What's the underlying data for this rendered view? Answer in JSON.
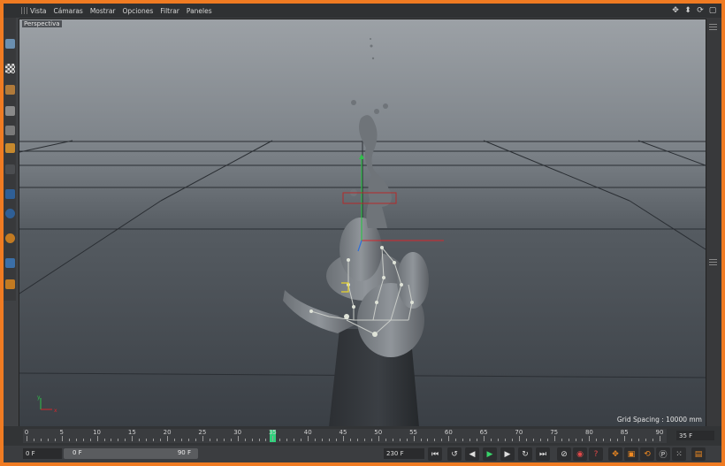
{
  "menu": {
    "items": [
      "Vista",
      "Cámaras",
      "Mostrar",
      "Opciones",
      "Filtrar",
      "Paneles"
    ]
  },
  "viewport": {
    "label": "Perspectiva",
    "grid_spacing": "Grid Spacing : 10000 mm",
    "axis_x": "x",
    "axis_y": "y"
  },
  "timeline": {
    "ticks": [
      "0",
      "5",
      "10",
      "15",
      "20",
      "25",
      "30",
      "35",
      "40",
      "45",
      "50",
      "55",
      "60",
      "65",
      "70",
      "75",
      "80",
      "85",
      "90"
    ],
    "current_frame_value": 35,
    "current_frame_display": "35 F"
  },
  "transport": {
    "start_field": "0 F",
    "range_start": "0 F",
    "range_end": "90 F",
    "end_field": "230 F"
  },
  "colors": {
    "app_border": "#f07b22",
    "accent_green": "#2fd07b",
    "axis_red": "#d6262c",
    "axis_green": "#2fbf4a",
    "axis_blue": "#2e6fd9"
  },
  "icons": {
    "nav": [
      "move-view-icon",
      "dolly-icon",
      "rotate-view-icon",
      "maximize-icon"
    ],
    "transport": [
      "goto-start-icon",
      "prev-key-icon",
      "prev-frame-icon",
      "play-icon",
      "next-frame-icon",
      "next-key-icon",
      "goto-end-icon",
      "record-icon",
      "autokey-icon",
      "keyframe-icon",
      "keyframe-sel-icon",
      "move-key-icon",
      "scale-key-icon",
      "rotate-key-icon",
      "param-key-icon",
      "pla-key-icon",
      "dots-icon",
      "film-icon"
    ]
  }
}
